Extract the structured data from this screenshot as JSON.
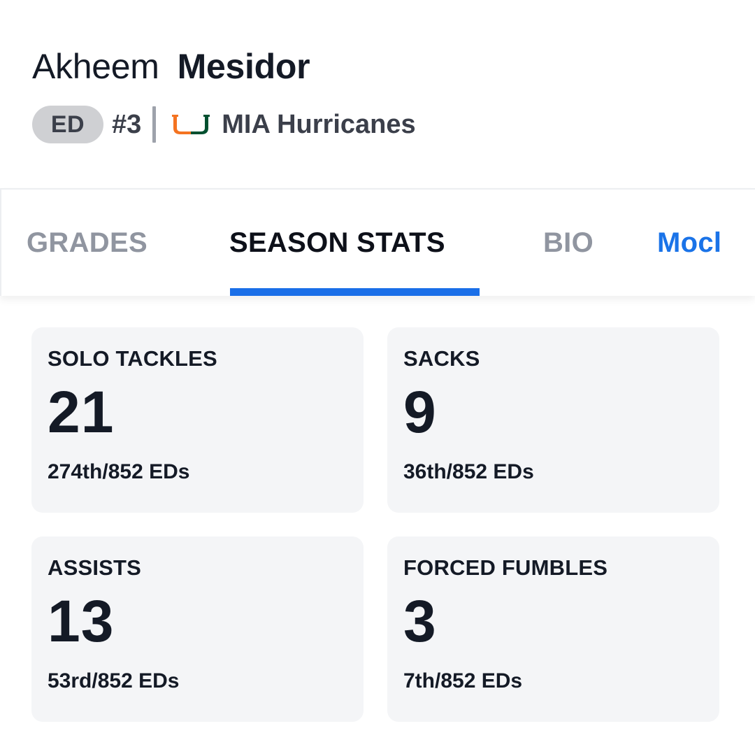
{
  "player": {
    "first_name": "Akheem",
    "last_name": "Mesidor",
    "position": "ED",
    "jersey": "#3",
    "team": "MIA Hurricanes",
    "team_logo_icon": "miami-u-logo-icon"
  },
  "tabs": [
    {
      "label": "GRADES",
      "active": false
    },
    {
      "label": "SEASON STATS",
      "active": true
    },
    {
      "label": "BIO",
      "active": false
    },
    {
      "label": "Mocl",
      "active": false
    }
  ],
  "colors": {
    "accent": "#1a6fe8",
    "card_bg": "#f4f5f7",
    "badge_bg": "#cfd0d3",
    "logo_orange": "#f47321",
    "logo_green": "#005030"
  },
  "stats": [
    {
      "label": "SOLO TACKLES",
      "value": "21",
      "rank": "274th/852 EDs"
    },
    {
      "label": "SACKS",
      "value": "9",
      "rank": "36th/852 EDs"
    },
    {
      "label": "ASSISTS",
      "value": "13",
      "rank": "53rd/852 EDs"
    },
    {
      "label": "FORCED FUMBLES",
      "value": "3",
      "rank": "7th/852 EDs"
    }
  ]
}
